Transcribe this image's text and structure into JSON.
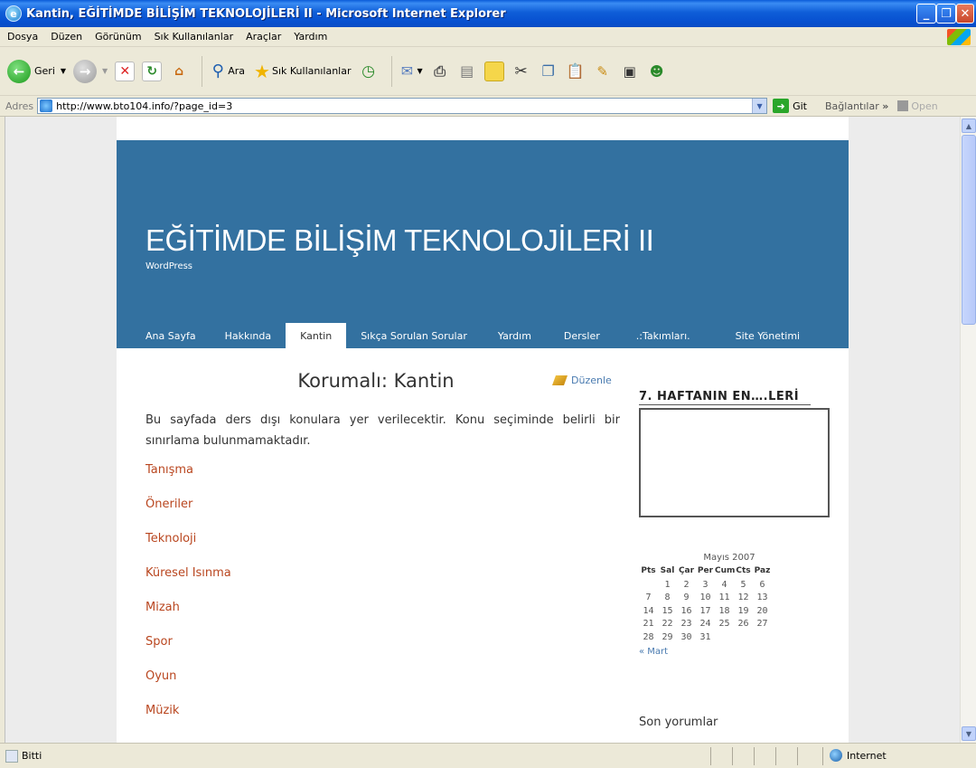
{
  "window": {
    "title": "Kantin, EĞİTİMDE BİLİŞİM TEKNOLOJİLERİ II - Microsoft Internet Explorer"
  },
  "menu": {
    "items": [
      "Dosya",
      "Düzen",
      "Görünüm",
      "Sık Kullanılanlar",
      "Araçlar",
      "Yardım"
    ]
  },
  "toolbar": {
    "back_label": "Geri",
    "search_label": "Ara",
    "favorites_label": "Sık Kullanılanlar"
  },
  "address": {
    "label": "Adres",
    "url": "http://www.bto104.info/?page_id=3",
    "go_label": "Git",
    "links_label": "Bağlantılar",
    "open_label": "Open"
  },
  "site": {
    "title": "EĞİTİMDE BİLİŞİM TEKNOLOJİLERİ II",
    "tagline": "WordPress",
    "nav": [
      "Ana Sayfa",
      "Hakkında",
      "Kantin",
      "Sıkça Sorulan Sorular",
      "Yardım",
      "Dersler",
      ".:Takımları.",
      "Site Yönetimi"
    ]
  },
  "post": {
    "title": "Korumalı: Kantin",
    "edit_label": "Düzenle",
    "intro": "Bu sayfada ders dışı konulara yer verilecektir. Konu seçiminde  belirli bir sınırlama bulunmamaktadır.",
    "links": [
      "Tanışma",
      "Öneriler",
      "Teknoloji",
      "Küresel Isınma",
      "Mizah",
      "Spor",
      "Oyun",
      "Müzik"
    ]
  },
  "sidebar": {
    "widget_title": "7. HAFTANIN EN….LERİ",
    "calendar": {
      "caption": "Mayıs 2007",
      "days": [
        "Pts",
        "Sal",
        "Çar",
        "Per",
        "Cum",
        "Cts",
        "Paz"
      ],
      "weeks": [
        [
          "",
          "1",
          "2",
          "3",
          "4",
          "5",
          "6"
        ],
        [
          "7",
          "8",
          "9",
          "10",
          "11",
          "12",
          "13"
        ],
        [
          "14",
          "15",
          "16",
          "17",
          "18",
          "19",
          "20"
        ],
        [
          "21",
          "22",
          "23",
          "24",
          "25",
          "26",
          "27"
        ],
        [
          "28",
          "29",
          "30",
          "31",
          "",
          "",
          ""
        ]
      ],
      "prev_label": "« Mart"
    },
    "recent_comments_title": "Son yorumlar"
  },
  "status": {
    "text": "Bitti",
    "zone": "Internet"
  }
}
